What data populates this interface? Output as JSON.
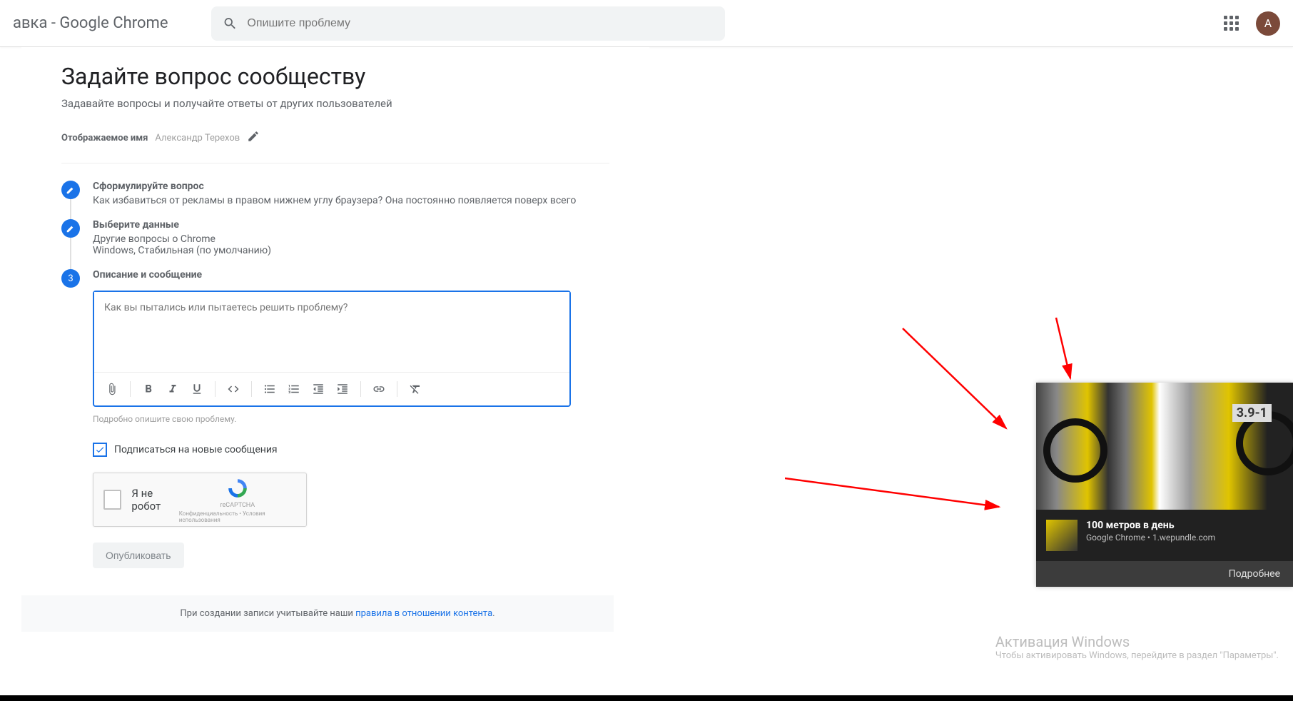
{
  "header": {
    "title_partial": "авка - Google Chrome",
    "search_placeholder": "Опишите проблему",
    "avatar_initial": "А"
  },
  "page": {
    "heading": "Задайте вопрос сообществу",
    "subtitle": "Задавайте вопросы и получайте ответы от других пользователей",
    "display_name_label": "Отображаемое имя",
    "display_name_value": "Александр Терехов"
  },
  "steps": {
    "s1": {
      "title": "Сформулируйте вопрос",
      "desc": "Как избавиться от рекламы в правом нижнем углу браузера? Она постоянно появляется поверх всего"
    },
    "s2": {
      "title": "Выберите данные",
      "desc1": "Другие вопросы о Chrome",
      "desc2": "Windows, Стабильная (по умолчанию)"
    },
    "s3": {
      "title": "Описание и сообщение",
      "number": "3"
    }
  },
  "editor": {
    "placeholder": "Как вы пытались или пытаетесь решить проблему?",
    "helper": "Подробно опишите свою проблему."
  },
  "subscribe": {
    "label": "Подписаться на новые сообщения"
  },
  "recaptcha": {
    "label": "Я не робот",
    "brand": "reCAPTCHA",
    "terms": "Конфиденциальность • Условия использования"
  },
  "publish": {
    "label": "Опубликовать"
  },
  "footer": {
    "prefix": "При создании записи учитывайте наши ",
    "link": "правила в отношении контента",
    "suffix": "."
  },
  "notification": {
    "badge_text": "3.9-1",
    "title": "100 метров в день",
    "source": "Google Chrome • 1.wepundle.com",
    "more": "Подробнее"
  },
  "watermark": {
    "line1": "Активация Windows",
    "line2": "Чтобы активировать Windows, перейдите в раздел \"Параметры\"."
  }
}
